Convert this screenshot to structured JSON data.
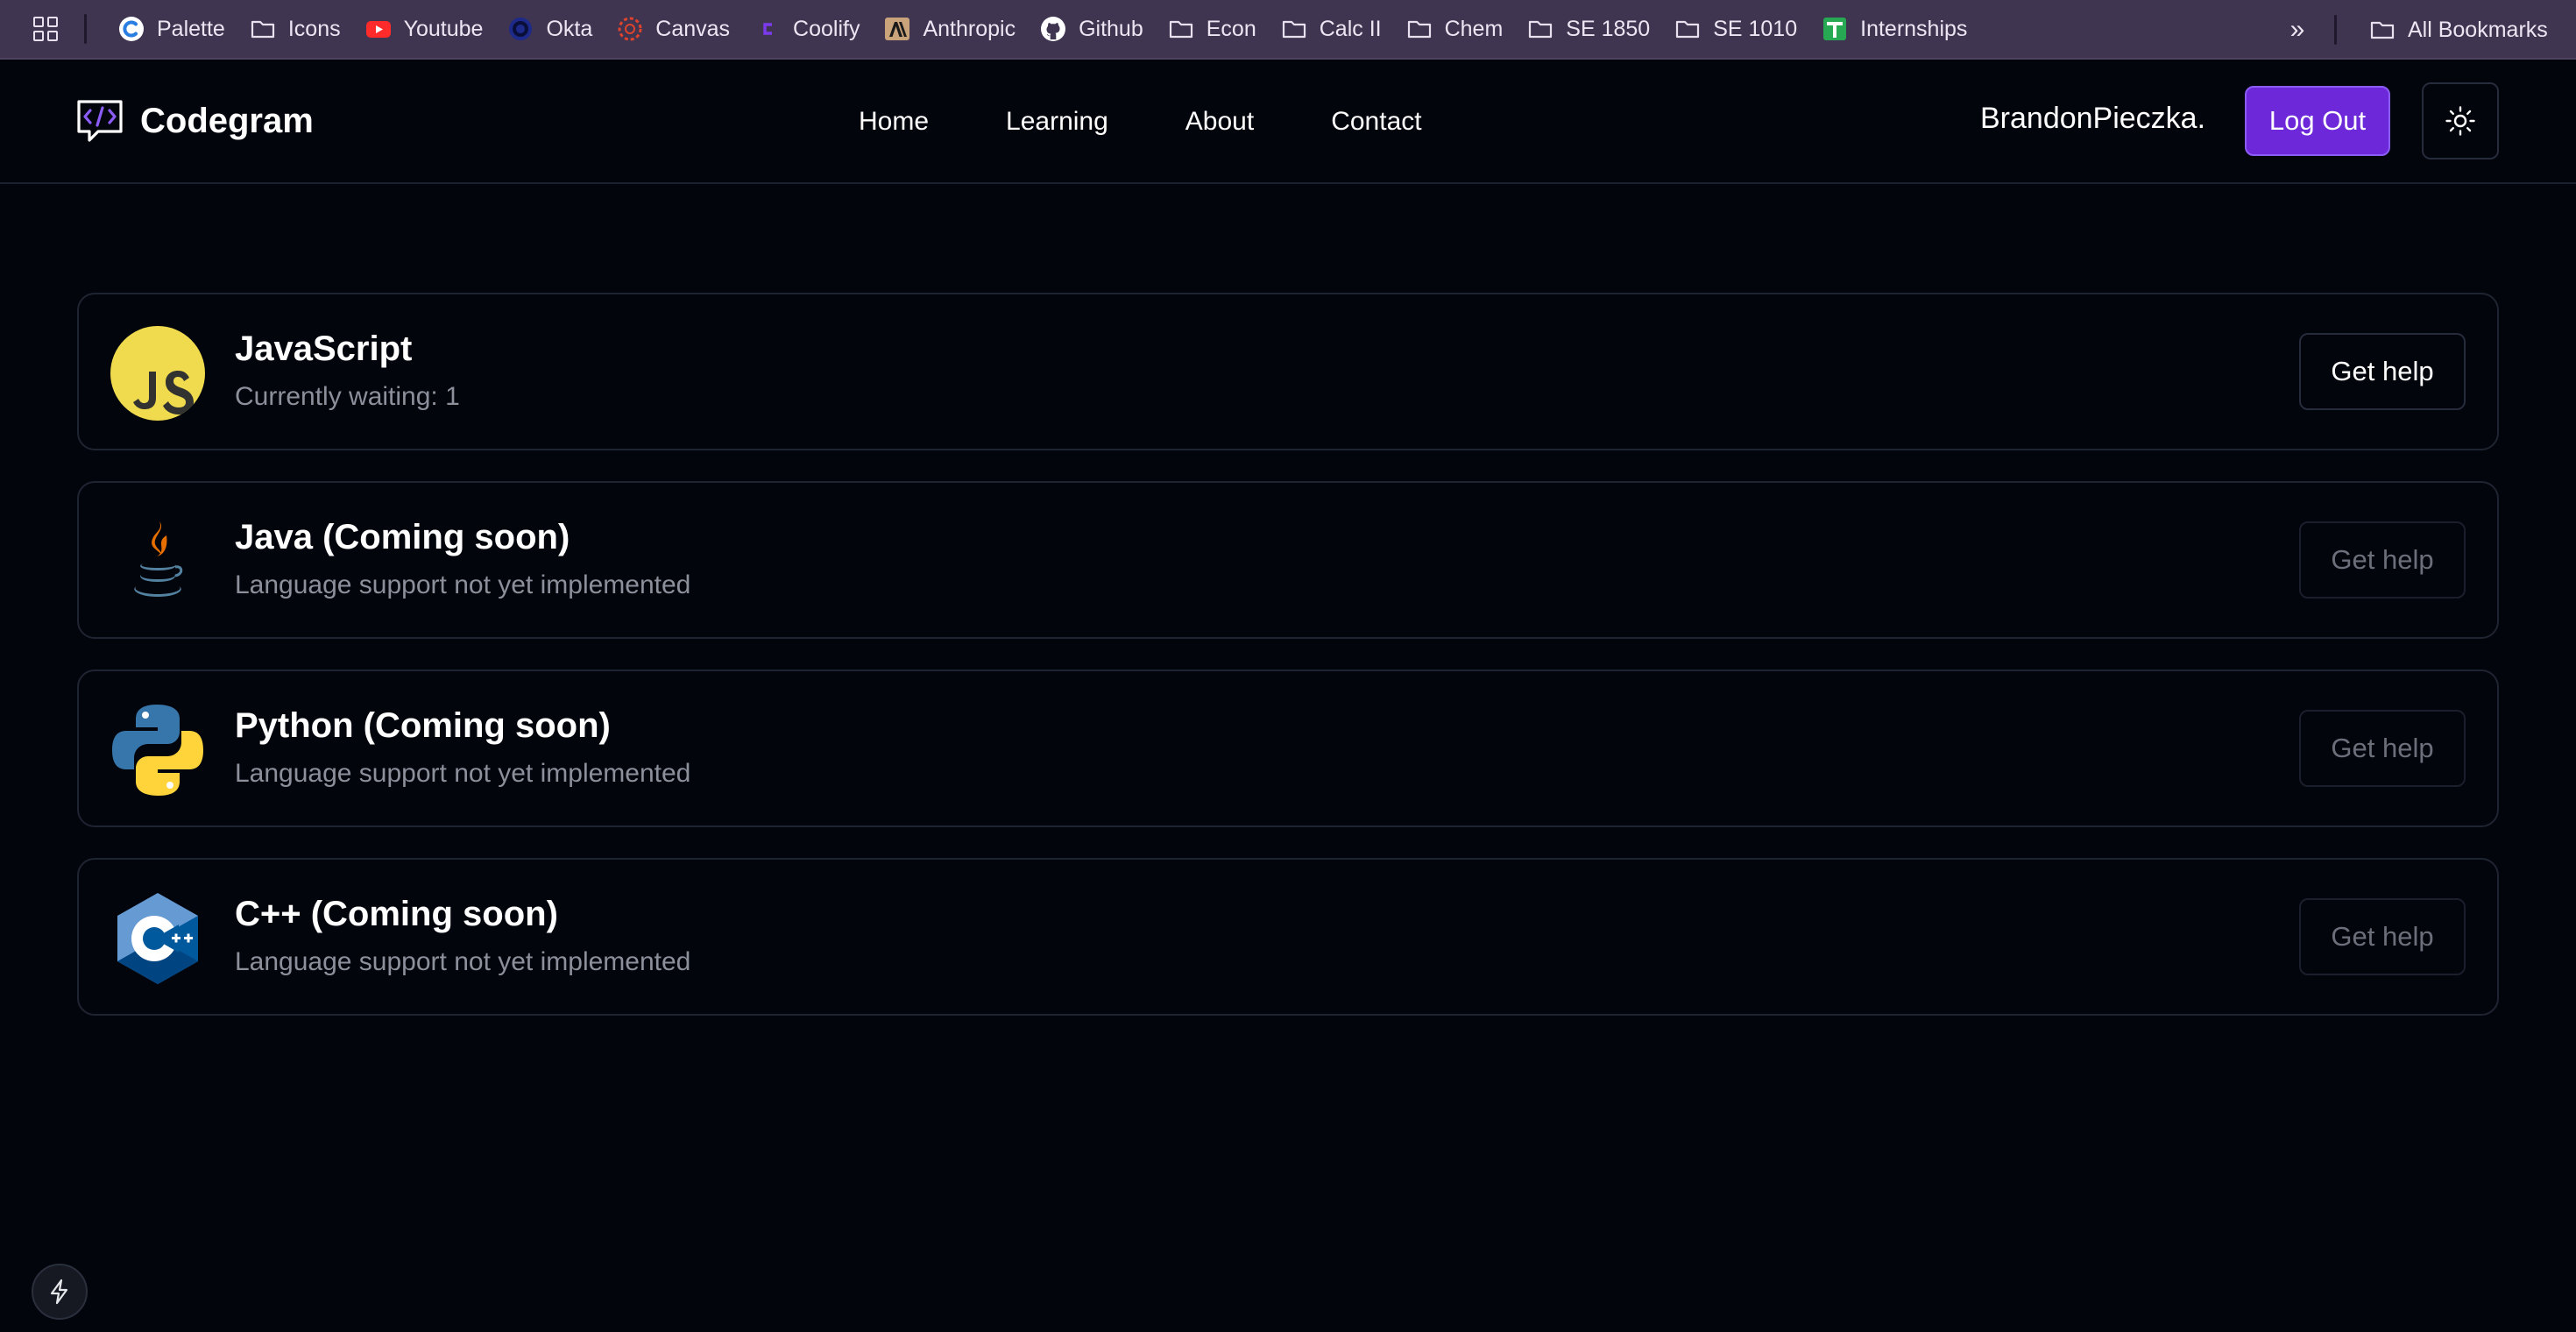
{
  "bookmarks": {
    "items": [
      {
        "label": "Palette",
        "icon": "palette-icon"
      },
      {
        "label": "Icons",
        "icon": "folder-icon"
      },
      {
        "label": "Youtube",
        "icon": "youtube-icon"
      },
      {
        "label": "Okta",
        "icon": "okta-icon"
      },
      {
        "label": "Canvas",
        "icon": "canvas-icon"
      },
      {
        "label": "Coolify",
        "icon": "coolify-icon"
      },
      {
        "label": "Anthropic",
        "icon": "anthropic-icon"
      },
      {
        "label": "Github",
        "icon": "github-icon"
      },
      {
        "label": "Econ",
        "icon": "folder-icon"
      },
      {
        "label": "Calc II",
        "icon": "folder-icon"
      },
      {
        "label": "Chem",
        "icon": "folder-icon"
      },
      {
        "label": "SE 1850",
        "icon": "folder-icon"
      },
      {
        "label": "SE 1010",
        "icon": "folder-icon"
      },
      {
        "label": "Internships",
        "icon": "sheets-icon"
      }
    ],
    "more_label": "»",
    "all_label": "All Bookmarks"
  },
  "header": {
    "brand": "Codegram",
    "nav": [
      {
        "label": "Home"
      },
      {
        "label": "Learning"
      },
      {
        "label": "About"
      },
      {
        "label": "Contact"
      }
    ],
    "username": "BrandonPieczka.",
    "logout_label": "Log Out"
  },
  "languages": [
    {
      "name": "JavaScript",
      "status": "Currently waiting: 1",
      "button": "Get help",
      "enabled": true,
      "icon": "javascript-icon"
    },
    {
      "name": "Java (Coming soon)",
      "status": "Language support not yet implemented",
      "button": "Get help",
      "enabled": false,
      "icon": "java-icon"
    },
    {
      "name": "Python (Coming soon)",
      "status": "Language support not yet implemented",
      "button": "Get help",
      "enabled": false,
      "icon": "python-icon"
    },
    {
      "name": "C++ (Coming soon)",
      "status": "Language support not yet implemented",
      "button": "Get help",
      "enabled": false,
      "icon": "cpp-icon"
    }
  ],
  "colors": {
    "background": "#03050d",
    "accent": "#6d28d9",
    "bookmarks_bar": "#3f3550",
    "muted_text": "#8c909b"
  }
}
